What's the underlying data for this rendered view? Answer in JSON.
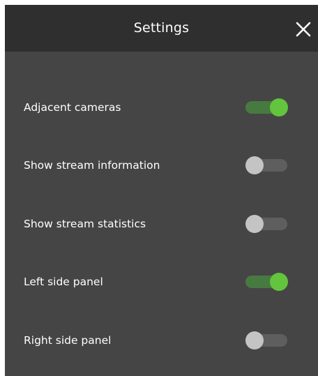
{
  "dialog": {
    "title": "Settings",
    "close_icon": "close-icon"
  },
  "settings": [
    {
      "label": "Adjacent cameras",
      "enabled": true
    },
    {
      "label": "Show stream information",
      "enabled": false
    },
    {
      "label": "Show stream statistics",
      "enabled": false
    },
    {
      "label": "Left side panel",
      "enabled": true
    },
    {
      "label": "Right side panel",
      "enabled": false
    }
  ],
  "colors": {
    "panel_background": "#454545",
    "header_background": "#2f2f2f",
    "text": "#ffffff",
    "toggle_on_knob": "#63c43e",
    "toggle_on_track": "#477a40",
    "toggle_off_knob": "#c4c4c4",
    "toggle_off_track": "#5e5e5e"
  }
}
